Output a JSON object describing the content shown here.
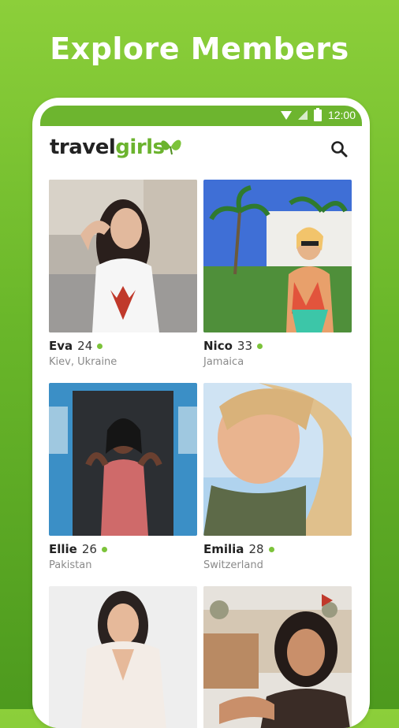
{
  "headline": "Explore Members",
  "status": {
    "time": "12:00"
  },
  "brand": {
    "part1": "travel",
    "part2": "girls"
  },
  "icons": {
    "search": "search-icon",
    "wifi": "wifi-icon",
    "signal": "signal-icon",
    "battery": "battery-icon",
    "logo_mark": "butterfly-leaf-icon"
  },
  "colors": {
    "accent": "#6bb32e",
    "online": "#7cc33a",
    "background": "#7ec235"
  },
  "members": [
    {
      "name": "Eva",
      "age": "24",
      "location": "Kiev, Ukraine",
      "online": true
    },
    {
      "name": "Nico",
      "age": "33",
      "location": "Jamaica",
      "online": true
    },
    {
      "name": "Ellie",
      "age": "26",
      "location": "Pakistan",
      "online": true
    },
    {
      "name": "Emilia",
      "age": "28",
      "location": "Switzerland",
      "online": true
    },
    {
      "name": "",
      "age": "",
      "location": "",
      "online": false
    },
    {
      "name": "",
      "age": "",
      "location": "",
      "online": false
    }
  ]
}
